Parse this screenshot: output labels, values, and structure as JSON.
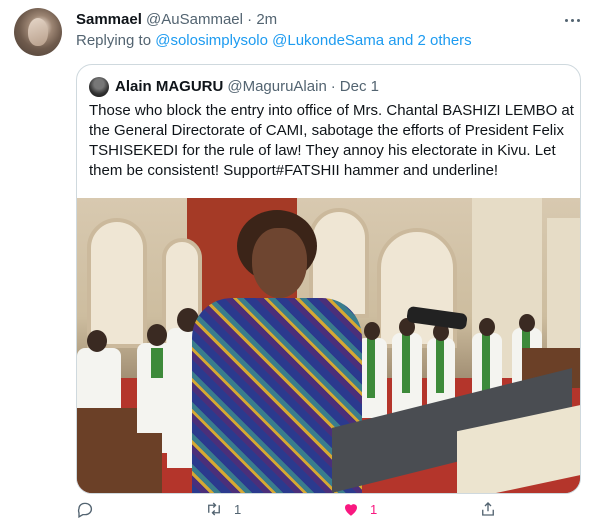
{
  "tweet": {
    "display_name": "Sammael",
    "handle": "@AuSammael",
    "separator": "·",
    "time": "2m",
    "replying_prefix": "Replying to",
    "replying_to": "@solosimplysolo @LukondeSama and 2 others"
  },
  "quote": {
    "display_name": "Alain MAGURU",
    "handle": "@MaguruAlain",
    "separator": "·",
    "date": "Dec 1",
    "text": "Those who block the entry into office of Mrs. Chantal BASHIZI LEMBO at the General Directorate of CAMI, sabotage the efforts of President Felix TSHISEKEDI for the rule of law! They annoy his electorate in Kivu. Let them be consistent! Support#FATSHII hammer and underline!",
    "image_icon": "photo-woman-at-lectern-in-church"
  },
  "actions": {
    "reply_count": "",
    "retweet_count": "1",
    "like_count": "1",
    "like_color": "#f91880",
    "icons": [
      "reply-icon",
      "retweet-icon",
      "like-icon",
      "share-icon"
    ]
  },
  "colors": {
    "link": "#1d9bf0",
    "secondary_text": "#536471",
    "border": "#cfd9de"
  }
}
